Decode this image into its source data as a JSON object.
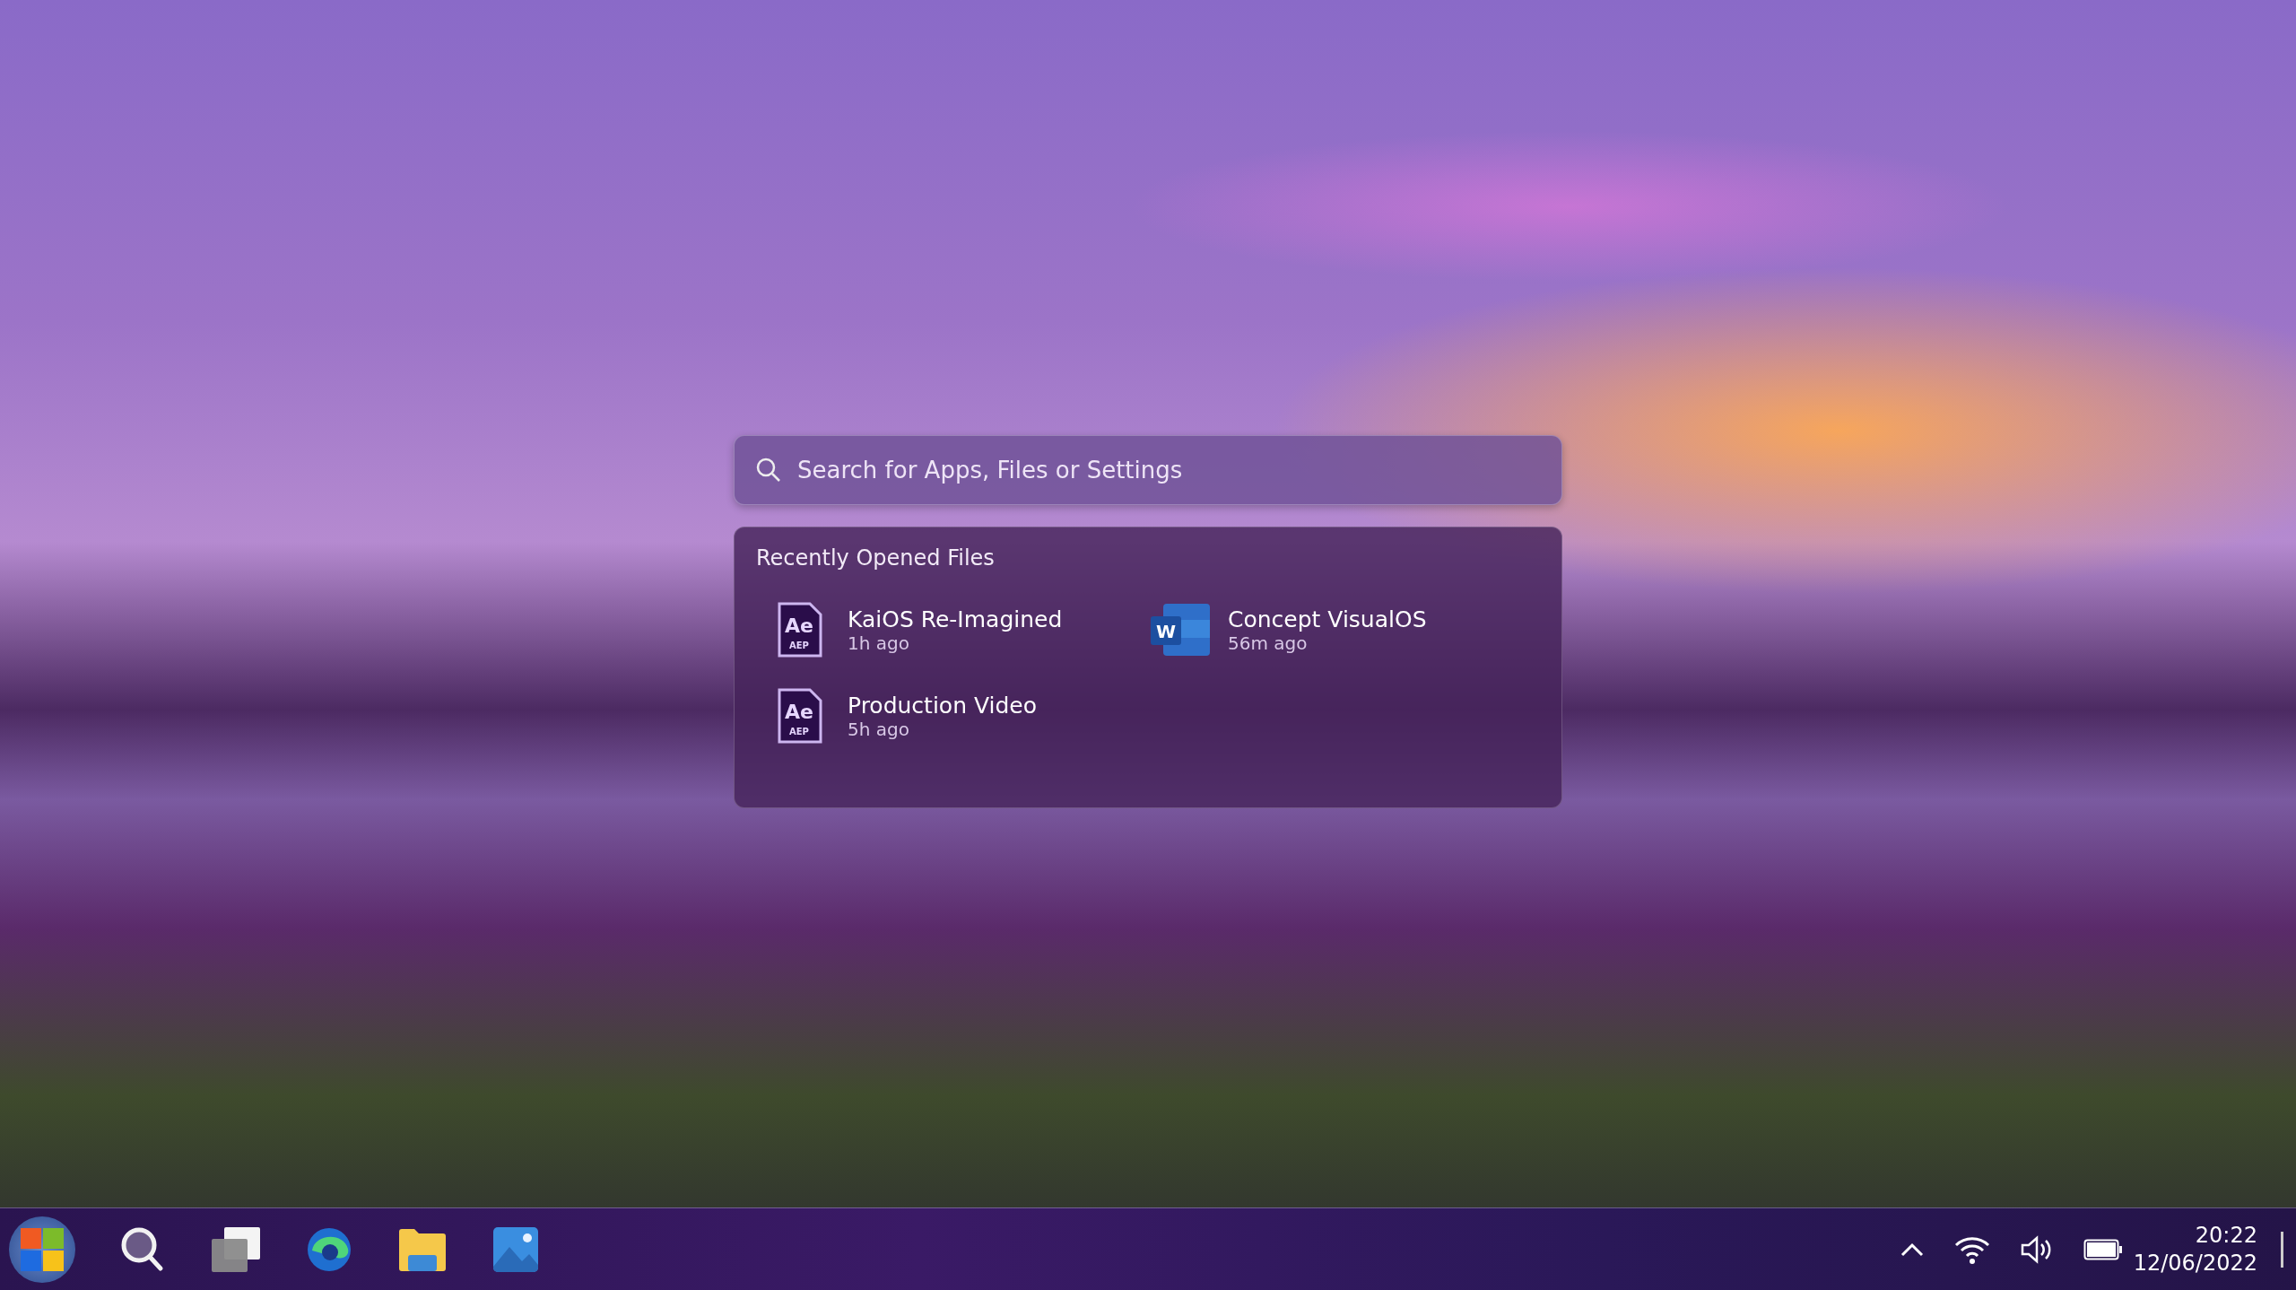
{
  "search": {
    "placeholder": "Search for Apps, Files or Settings"
  },
  "recent": {
    "title": "Recently Opened Files",
    "files": [
      {
        "name": "KaiOS Re-Imagined",
        "time": "1h ago",
        "kind": "ae",
        "icon_text": "Ae",
        "icon_subtext": "AEP"
      },
      {
        "name": "Concept VisualOS",
        "time": "56m ago",
        "kind": "word",
        "icon_text": "W"
      },
      {
        "name": "Production Video",
        "time": "5h ago",
        "kind": "ae",
        "icon_text": "Ae",
        "icon_subtext": "AEP"
      }
    ]
  },
  "taskbar": {
    "time": "20:22",
    "date": "12/06/2022"
  }
}
